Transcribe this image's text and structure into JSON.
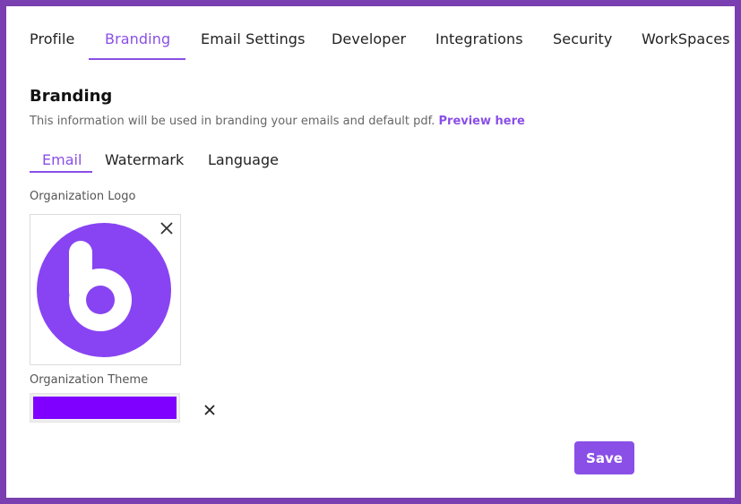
{
  "nav": {
    "tabs": [
      {
        "label": "Profile"
      },
      {
        "label": "Branding"
      },
      {
        "label": "Email Settings"
      },
      {
        "label": "Developer"
      },
      {
        "label": "Integrations"
      },
      {
        "label": "Security"
      },
      {
        "label": "WorkSpaces"
      }
    ],
    "active_tab": "Branding"
  },
  "branding": {
    "title": "Branding",
    "description": "This information will be used in branding your emails and default pdf. ",
    "preview_link": "Preview here",
    "sub_tabs": [
      {
        "label": "Email"
      },
      {
        "label": "Watermark"
      },
      {
        "label": "Language"
      }
    ],
    "active_sub_tab": "Email",
    "logo_label": "Organization Logo",
    "logo_remove_icon": "close-icon",
    "theme_label": "Organization Theme",
    "theme_color": "#8000ff",
    "theme_remove_icon": "close-icon",
    "save_label": "Save"
  },
  "colors": {
    "accent": "#8a4fe6",
    "frame": "#7a3fb0",
    "logo_purple": "#8844f2"
  }
}
